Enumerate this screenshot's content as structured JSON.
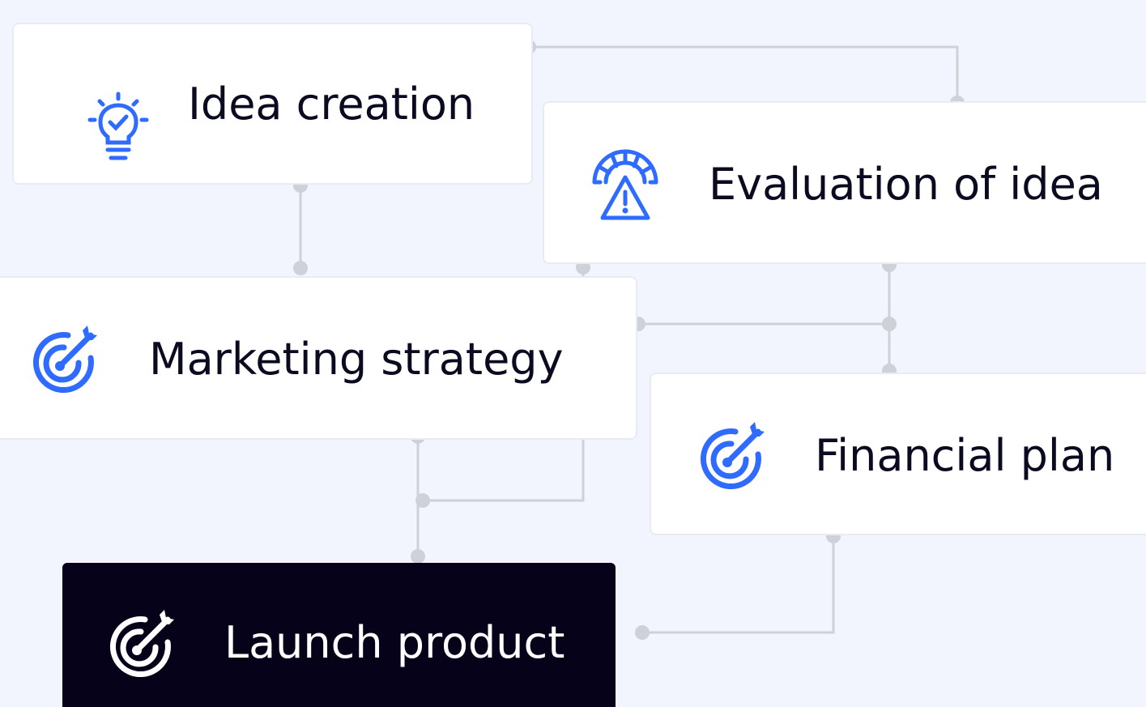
{
  "nodes": {
    "idea_creation": {
      "label": "Idea creation",
      "icon": "lightbulb-icon"
    },
    "evaluation": {
      "label": "Evaluation of idea",
      "icon": "gauge-warning-icon"
    },
    "marketing": {
      "label": "Marketing strategy",
      "icon": "target-icon"
    },
    "financial": {
      "label": "Financial plan",
      "icon": "target-icon"
    },
    "launch": {
      "label": "Launch product",
      "icon": "target-icon"
    }
  },
  "colors": {
    "background": "#f2f5fd",
    "card": "#ffffff",
    "card_dark": "#05021a",
    "accent_blue": "#2f6bff",
    "connector": "#cfd1d8",
    "text_dark": "#0a0a20",
    "text_light": "#ffffff"
  }
}
